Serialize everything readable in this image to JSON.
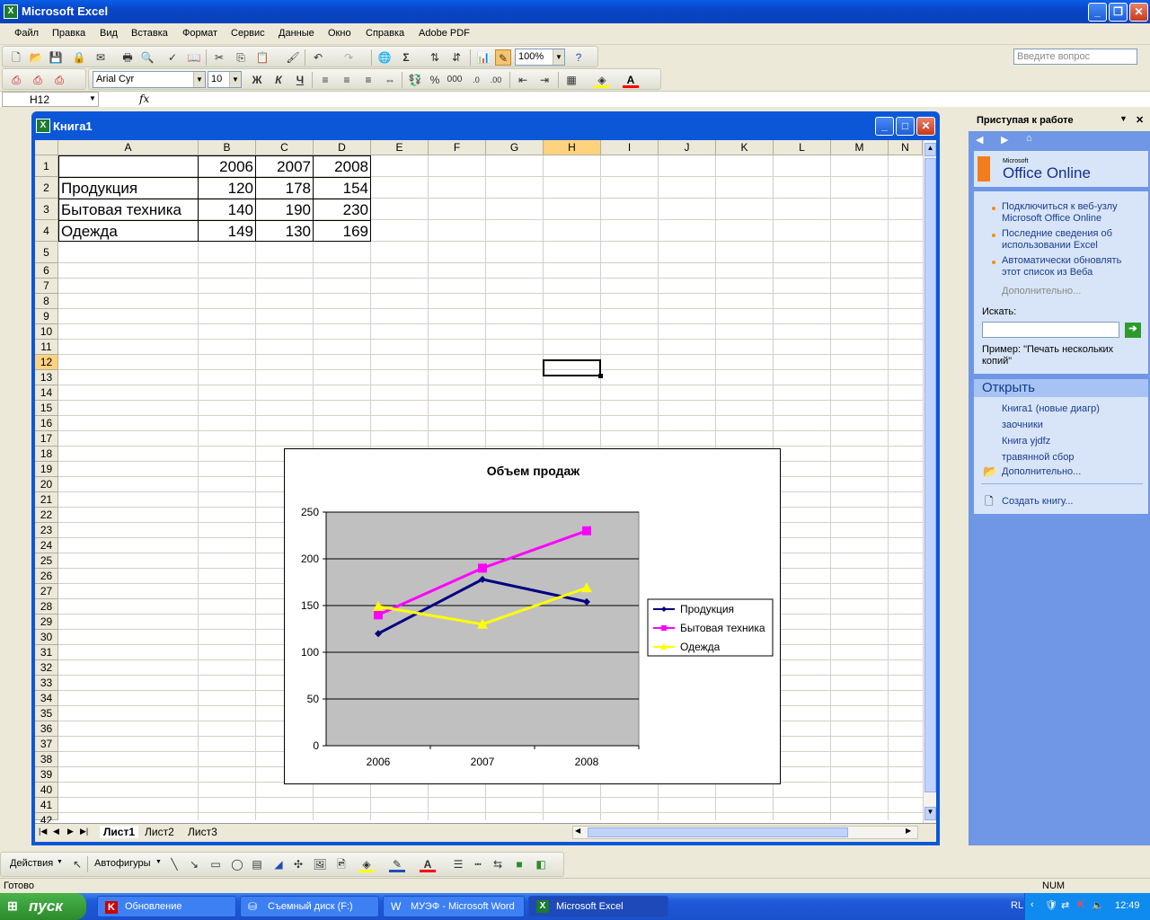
{
  "app": {
    "title": "Microsoft Excel"
  },
  "menu": {
    "items": [
      "Файл",
      "Правка",
      "Вид",
      "Вставка",
      "Формат",
      "Сервис",
      "Данные",
      "Окно",
      "Справка",
      "Adobe PDF"
    ],
    "help_placeholder": "Введите вопрос"
  },
  "toolbar": {
    "zoom": "100%",
    "font": "Arial Cyr",
    "size": "10",
    "bold": "Ж",
    "italic": "К",
    "underline": "Ч",
    "percent": "%",
    "thousands": "000"
  },
  "formula": {
    "cell_ref": "H12",
    "fx": "fx",
    "value": ""
  },
  "workbook": {
    "title": "Книга1",
    "columns": [
      "A",
      "B",
      "C",
      "D",
      "E",
      "F",
      "G",
      "H",
      "I",
      "J",
      "K",
      "L",
      "M",
      "N"
    ],
    "selected_cell": "H12",
    "table": [
      {
        "row": 1,
        "a": "",
        "b": "2006",
        "c": "2007",
        "d": "2008"
      },
      {
        "row": 2,
        "a": "Продукция",
        "b": "120",
        "c": "178",
        "d": "154"
      },
      {
        "row": 3,
        "a": "Бытовая техника",
        "b": "140",
        "c": "190",
        "d": "230"
      },
      {
        "row": 4,
        "a": "Одежда",
        "b": "149",
        "c": "130",
        "d": "169"
      }
    ],
    "sheets": [
      "Лист1",
      "Лист2",
      "Лист3"
    ],
    "active_sheet": "Лист1"
  },
  "chart_data": {
    "type": "line",
    "title": "Объем продаж",
    "categories": [
      "2006",
      "2007",
      "2008"
    ],
    "ylim": [
      0,
      250
    ],
    "yticks": [
      0,
      50,
      100,
      150,
      200,
      250
    ],
    "grid": true,
    "legend_position": "right",
    "plot_background": "#c0c0c0",
    "series": [
      {
        "name": "Продукция",
        "values": [
          120,
          178,
          154
        ],
        "color": "#000080",
        "marker": "diamond"
      },
      {
        "name": "Бытовая техника",
        "values": [
          140,
          190,
          230
        ],
        "color": "#ff00ff",
        "marker": "square"
      },
      {
        "name": "Одежда",
        "values": [
          149,
          130,
          169
        ],
        "color": "#ffff00",
        "marker": "triangle"
      }
    ]
  },
  "taskpane": {
    "title": "Приступая к работе",
    "brand": "Office Online",
    "brand_small": "Microsoft",
    "links": [
      "Подключиться к веб-узлу Microsoft Office Online",
      "Последние сведения об использовании Excel",
      "Автоматически обновлять этот список из Веба"
    ],
    "more": "Дополнительно...",
    "search_label": "Искать:",
    "example": "Пример:  \"Печать нескольких копий\"",
    "open_header": "Открыть",
    "recent": [
      "Книга1 (новые диагр)",
      "заочники",
      "Книга yjdfz",
      "травянной сбор"
    ],
    "open_more": "Дополнительно...",
    "create": "Создать книгу..."
  },
  "drawing": {
    "actions": "Действия",
    "autoshapes": "Автофигуры"
  },
  "status": {
    "left": "Готово",
    "num": "NUM"
  },
  "taskbar": {
    "start": "пуск",
    "buttons": [
      "Обновление",
      "Съемный диск (F:)",
      "МУЭФ - Microsoft Word",
      "Microsoft Excel"
    ],
    "lang": "RL",
    "time": "12:49"
  }
}
